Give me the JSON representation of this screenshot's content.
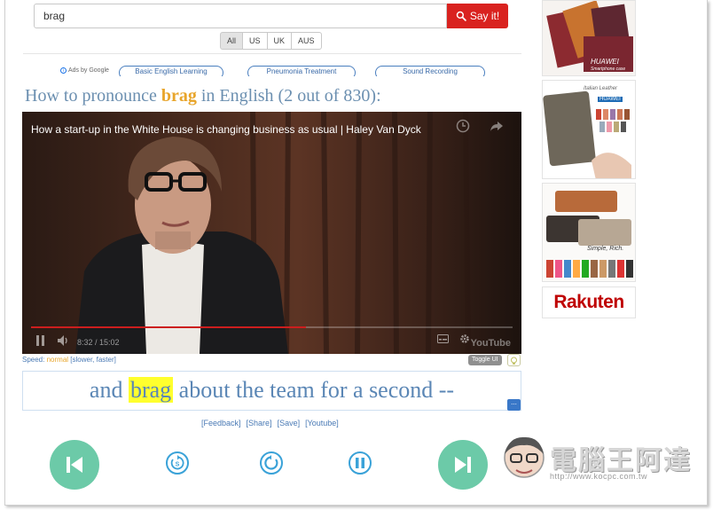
{
  "search": {
    "value": "brag",
    "button_label": "Say it!"
  },
  "accents": [
    "All",
    "US",
    "UK",
    "AUS"
  ],
  "ads": {
    "ads_by": "Ads by Google",
    "links": [
      "Basic English Learning",
      "Pneumonia Treatment",
      "Sound Recording"
    ]
  },
  "heading": {
    "prefix": "How to pronounce",
    "word": "brag",
    "suffix": "in English (2 out of 830):"
  },
  "video": {
    "title": "How a start-up in the White House is changing business as usual | Haley Van Dyck",
    "time": "8:32 / 15:02",
    "brand": "YouTube",
    "progress": 0.57
  },
  "speed": {
    "label": "Speed:",
    "value": "normal",
    "options": "[slower, faster]"
  },
  "toggle_ui": "Toggle UI",
  "caption": {
    "before": "and",
    "word": "brag",
    "after": "about the team for a second --",
    "more": "..."
  },
  "links": [
    "[Feedback]",
    "[Share]",
    "[Save]",
    "[Youtube]"
  ],
  "sidebar_ad": {
    "brand1": "HUAWEI",
    "sub1": "Smartphone case",
    "brand2": "Italian Leather",
    "sub2": "HUAWEI",
    "brand3": "Simple, Rich.",
    "rakuten": "Rakuten"
  },
  "watermark": {
    "title": "電腦王阿達",
    "url": "http://www.kocpc.com.tw"
  },
  "colors": {
    "accent_red": "#d9221f",
    "heading_blue": "#6b8fb0",
    "word_orange": "#e8a52b",
    "player_green": "#6ccaa8",
    "player_blue": "#3aa2d8"
  }
}
